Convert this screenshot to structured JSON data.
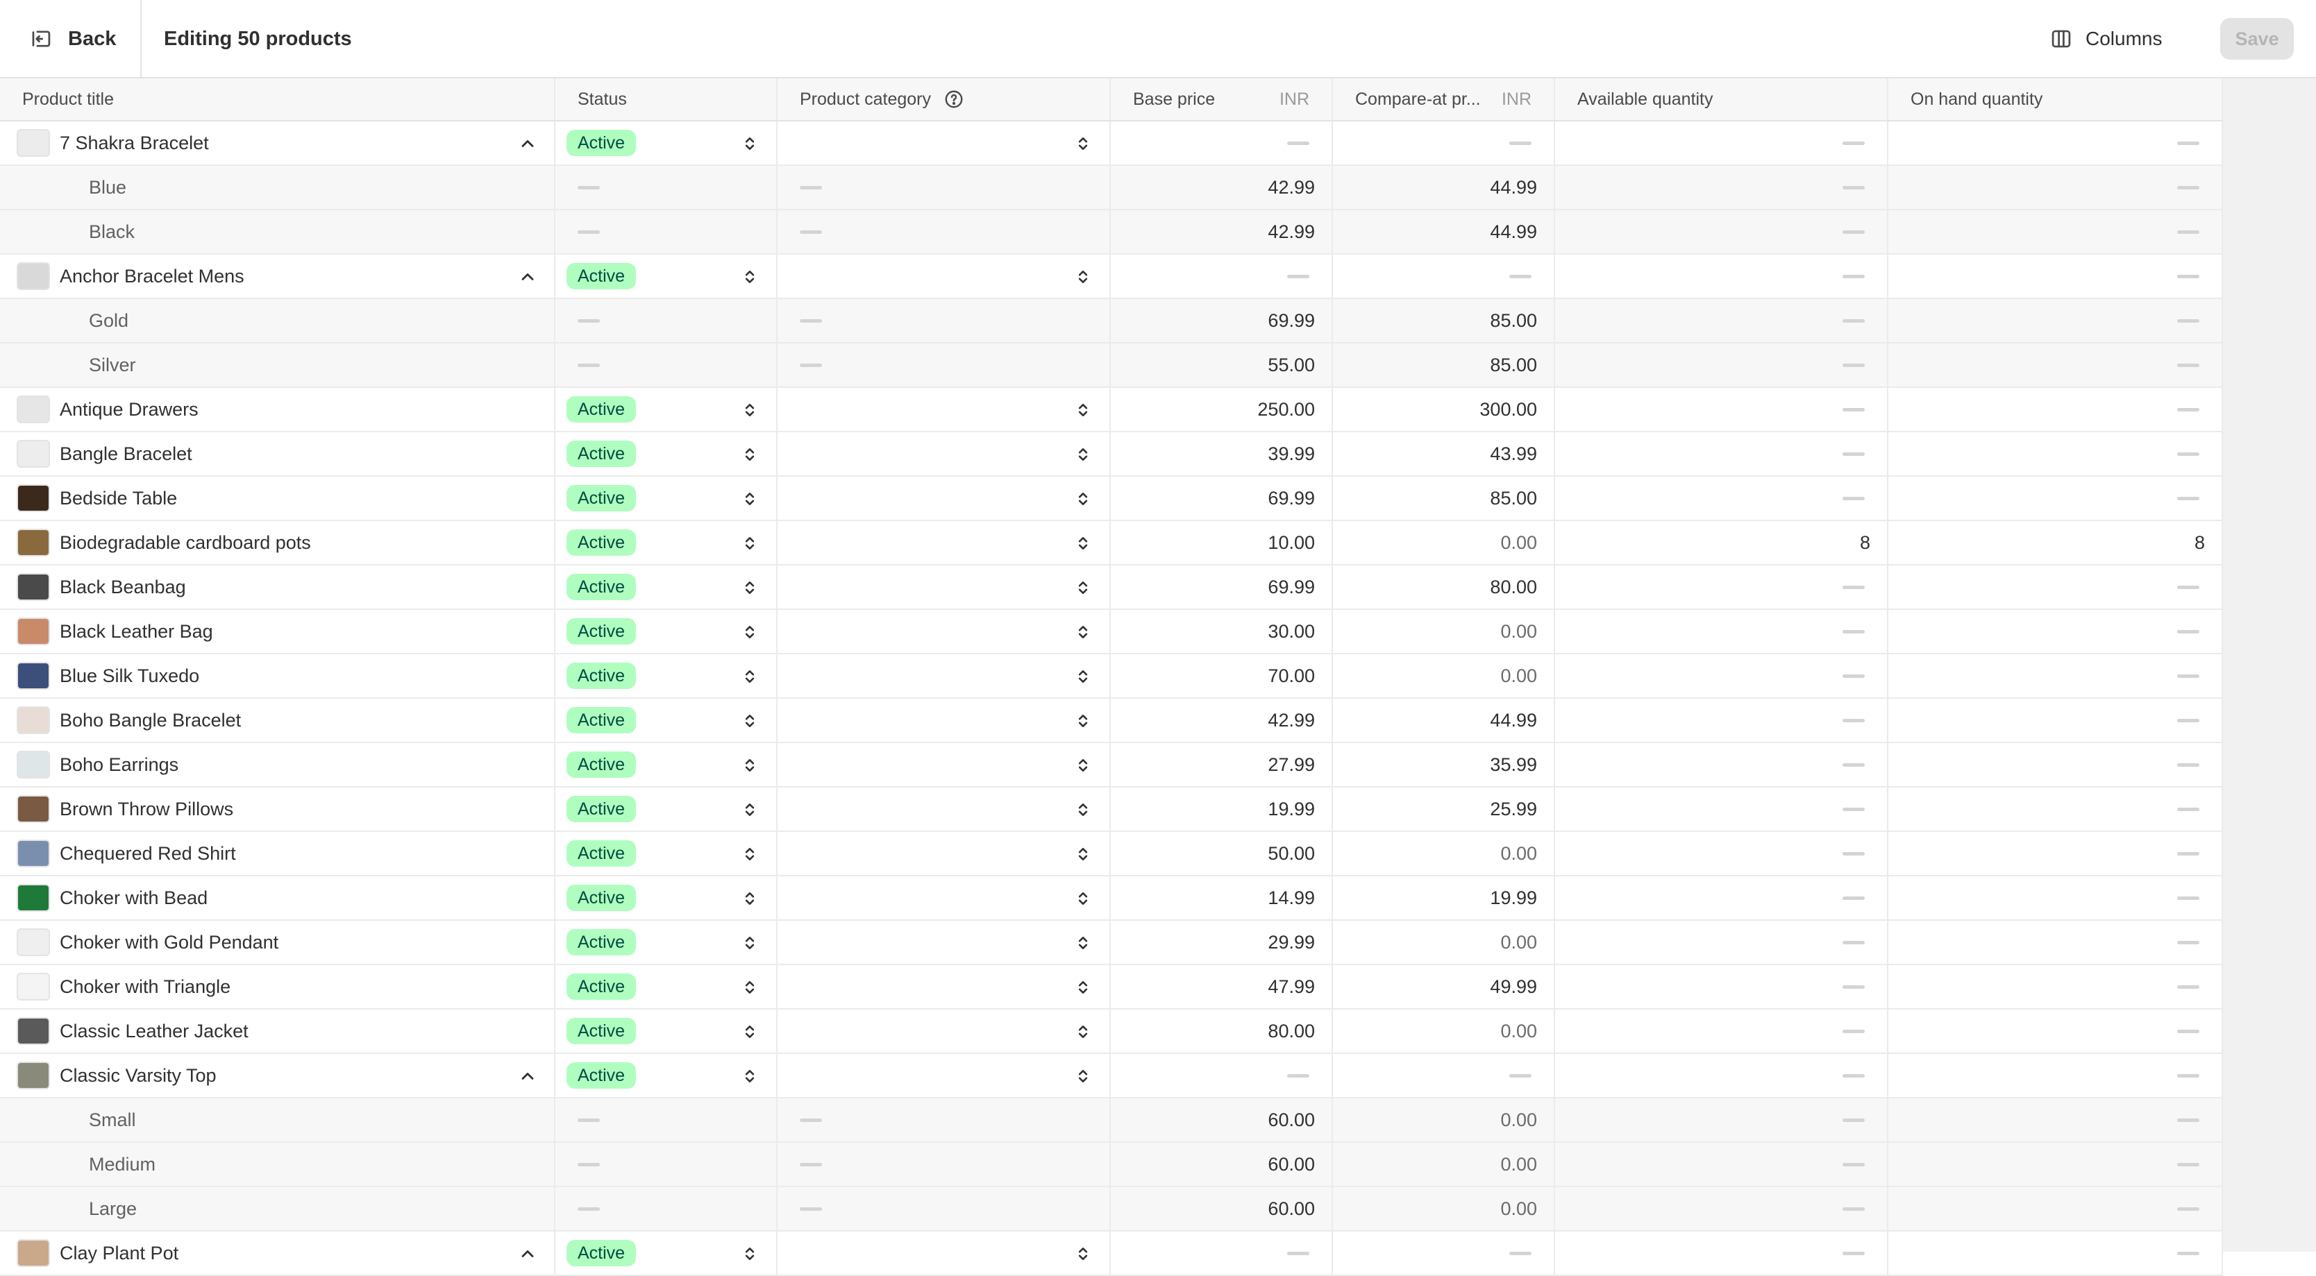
{
  "header": {
    "back_label": "Back",
    "title": "Editing 50 products",
    "columns_label": "Columns",
    "save_label": "Save"
  },
  "columns": {
    "title": "Product title",
    "status": "Status",
    "category": "Product category",
    "base_price": "Base price",
    "base_currency": "INR",
    "compare_price": "Compare-at pr...",
    "compare_currency": "INR",
    "available": "Available quantity",
    "on_hand": "On hand quantity"
  },
  "rows": [
    {
      "type": "product",
      "title": "7 Shakra Bracelet",
      "status": "Active",
      "expandable": true,
      "base": "",
      "compare": "",
      "avail": "",
      "onhand": "",
      "thumb": "#ececec"
    },
    {
      "type": "variant",
      "title": "Blue",
      "base": "42.99",
      "compare": "44.99"
    },
    {
      "type": "variant",
      "title": "Black",
      "base": "42.99",
      "compare": "44.99"
    },
    {
      "type": "product",
      "title": "Anchor Bracelet Mens",
      "status": "Active",
      "expandable": true,
      "base": "",
      "compare": "",
      "avail": "",
      "onhand": "",
      "thumb": "#d9d9d9"
    },
    {
      "type": "variant",
      "title": "Gold",
      "base": "69.99",
      "compare": "85.00"
    },
    {
      "type": "variant",
      "title": "Silver",
      "base": "55.00",
      "compare": "85.00"
    },
    {
      "type": "product",
      "title": "Antique Drawers",
      "status": "Active",
      "base": "250.00",
      "compare": "300.00",
      "thumb": "#e6e6e6"
    },
    {
      "type": "product",
      "title": "Bangle Bracelet",
      "status": "Active",
      "base": "39.99",
      "compare": "43.99",
      "thumb": "#ededed"
    },
    {
      "type": "product",
      "title": "Bedside Table",
      "status": "Active",
      "base": "69.99",
      "compare": "85.00",
      "thumb": "#3b2a1c"
    },
    {
      "type": "product",
      "title": "Biodegradable cardboard pots",
      "status": "Active",
      "base": "10.00",
      "compare": "0.00",
      "compare_muted": true,
      "avail": "8",
      "onhand": "8",
      "thumb": "#8a6a3c"
    },
    {
      "type": "product",
      "title": "Black Beanbag",
      "status": "Active",
      "base": "69.99",
      "compare": "80.00",
      "thumb": "#4a4a4a"
    },
    {
      "type": "product",
      "title": "Black Leather Bag",
      "status": "Active",
      "base": "30.00",
      "compare": "0.00",
      "compare_muted": true,
      "thumb": "#c98a6a"
    },
    {
      "type": "product",
      "title": "Blue Silk Tuxedo",
      "status": "Active",
      "base": "70.00",
      "compare": "0.00",
      "compare_muted": true,
      "thumb": "#3c4e7a"
    },
    {
      "type": "product",
      "title": "Boho Bangle Bracelet",
      "status": "Active",
      "base": "42.99",
      "compare": "44.99",
      "thumb": "#e8dcd6"
    },
    {
      "type": "product",
      "title": "Boho Earrings",
      "status": "Active",
      "base": "27.99",
      "compare": "35.99",
      "thumb": "#dfe6e8"
    },
    {
      "type": "product",
      "title": "Brown Throw Pillows",
      "status": "Active",
      "base": "19.99",
      "compare": "25.99",
      "thumb": "#7a5a42"
    },
    {
      "type": "product",
      "title": "Chequered Red Shirt",
      "status": "Active",
      "base": "50.00",
      "compare": "0.00",
      "compare_muted": true,
      "thumb": "#7a8fae"
    },
    {
      "type": "product",
      "title": "Choker with Bead",
      "status": "Active",
      "base": "14.99",
      "compare": "19.99",
      "thumb": "#1f7a3a"
    },
    {
      "type": "product",
      "title": "Choker with Gold Pendant",
      "status": "Active",
      "base": "29.99",
      "compare": "0.00",
      "compare_muted": true,
      "thumb": "#efefef"
    },
    {
      "type": "product",
      "title": "Choker with Triangle",
      "status": "Active",
      "base": "47.99",
      "compare": "49.99",
      "thumb": "#f4f4f4"
    },
    {
      "type": "product",
      "title": "Classic Leather Jacket",
      "status": "Active",
      "base": "80.00",
      "compare": "0.00",
      "compare_muted": true,
      "thumb": "#5a5a5a"
    },
    {
      "type": "product",
      "title": "Classic Varsity Top",
      "status": "Active",
      "expandable": true,
      "base": "",
      "compare": "",
      "thumb": "#8a8a7a"
    },
    {
      "type": "variant",
      "title": "Small",
      "base": "60.00",
      "compare": "0.00",
      "compare_muted": true
    },
    {
      "type": "variant",
      "title": "Medium",
      "base": "60.00",
      "compare": "0.00",
      "compare_muted": true
    },
    {
      "type": "variant",
      "title": "Large",
      "base": "60.00",
      "compare": "0.00",
      "compare_muted": true
    },
    {
      "type": "product",
      "title": "Clay Plant Pot",
      "status": "Active",
      "expandable": true,
      "base": "",
      "compare": "",
      "thumb": "#c9a98a"
    }
  ]
}
